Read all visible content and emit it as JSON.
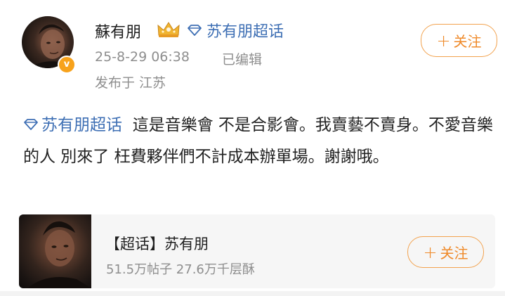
{
  "post": {
    "author_name": "蘇有朋",
    "author_badge_icon": "crown-icon",
    "topic_tag": "苏有朋超话",
    "timestamp": "25-8-29 06:38",
    "edited_label": "已编辑",
    "location": "发布于 江苏",
    "follow_label": "关注",
    "body_topic": "苏有朋超话",
    "body_text": "這是音樂會 不是合影會。我賣藝不賣身。不愛音樂的人 別來了 枉費夥伴們不計成本辦單場。謝謝哦。"
  },
  "card": {
    "title": "【超话】苏有朋",
    "stats": "51.5万帖子 27.6万千层酥",
    "follow_label": "关注"
  },
  "colors": {
    "accent_orange": "#ef8a2a",
    "link_blue": "#3e6fb4",
    "meta_gray": "#8e8e8e",
    "verified_badge": "#f7a21b"
  }
}
